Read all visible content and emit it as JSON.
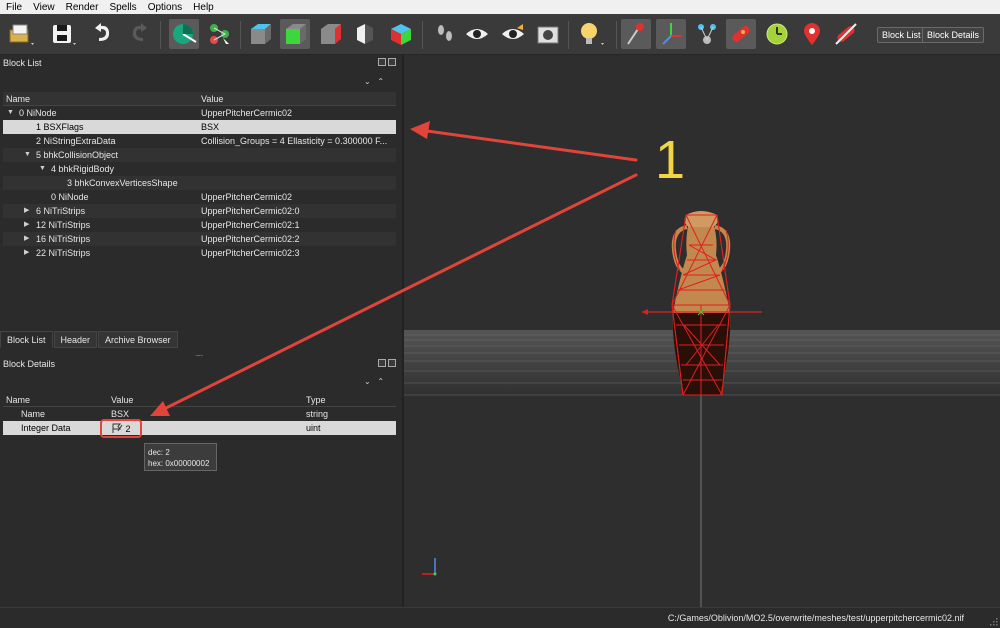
{
  "menu": [
    "File",
    "View",
    "Render",
    "Spells",
    "Options",
    "Help"
  ],
  "toolbar": {
    "block_list_label": "Block List",
    "block_details_label": "Block Details"
  },
  "block_list": {
    "title": "Block List",
    "columns": [
      "Name",
      "Value"
    ],
    "rows": [
      {
        "name": "0 NiNode",
        "value": "UpperPitcherCermic02",
        "indent": 0,
        "arrow": "down",
        "selected": false
      },
      {
        "name": "1 BSXFlags",
        "value": "BSX",
        "indent": 1,
        "arrow": "",
        "selected": true
      },
      {
        "name": "2 NiStringExtraData",
        "value": "Collision_Groups = 4  Ellasticity = 0.300000  F...",
        "indent": 1,
        "arrow": "",
        "selected": false
      },
      {
        "name": "5 bhkCollisionObject",
        "value": "",
        "indent": 1,
        "arrow": "down",
        "selected": false
      },
      {
        "name": "4 bhkRigidBody",
        "value": "",
        "indent": 2,
        "arrow": "down",
        "selected": false
      },
      {
        "name": "3 bhkConvexVerticesShape",
        "value": "",
        "indent": 3,
        "arrow": "",
        "selected": false
      },
      {
        "name": "0 NiNode",
        "value": "UpperPitcherCermic02",
        "indent": 2,
        "arrow": "",
        "selected": false
      },
      {
        "name": "6 NiTriStrips",
        "value": "UpperPitcherCermic02:0",
        "indent": 1,
        "arrow": "right",
        "selected": false
      },
      {
        "name": "12 NiTriStrips",
        "value": "UpperPitcherCermic02:1",
        "indent": 1,
        "arrow": "right",
        "selected": false
      },
      {
        "name": "16 NiTriStrips",
        "value": "UpperPitcherCermic02:2",
        "indent": 1,
        "arrow": "right",
        "selected": false
      },
      {
        "name": "22 NiTriStrips",
        "value": "UpperPitcherCermic02:3",
        "indent": 1,
        "arrow": "right",
        "selected": false
      }
    ]
  },
  "tabs": [
    "Block List",
    "Header",
    "Archive Browser"
  ],
  "block_details": {
    "title": "Block Details",
    "columns": [
      "Name",
      "Value",
      "Type"
    ],
    "rows": [
      {
        "name": "Name",
        "value": "BSX",
        "type": "string"
      },
      {
        "name": "Integer Data",
        "value": "2",
        "type": "uint"
      }
    ]
  },
  "tooltip": {
    "dec": "dec: 2",
    "hex": "hex: 0x00000002"
  },
  "annotation_number": "1",
  "status": {
    "path": "C:/Games/Oblivion/MO2.5/overwrite/meshes/test/upperpitchercermic02.nif"
  },
  "colors": {
    "annotation_red": "#e0443a",
    "annotation_yellow": "#f1d545",
    "selection": "#d9d9d9"
  }
}
